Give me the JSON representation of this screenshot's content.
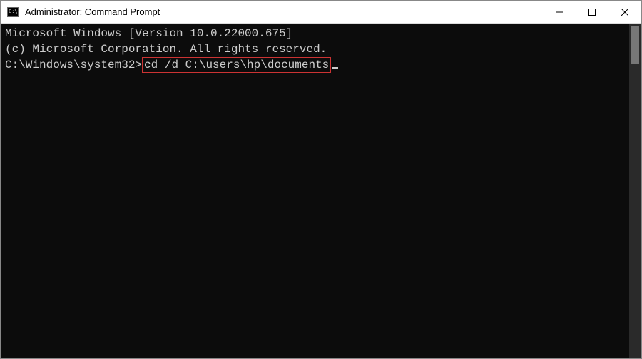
{
  "titlebar": {
    "icon_label": "C:\\",
    "title": "Administrator: Command Prompt"
  },
  "controls": {
    "minimize_label": "Minimize",
    "maximize_label": "Maximize",
    "close_label": "Close"
  },
  "console": {
    "line1": "Microsoft Windows [Version 10.0.22000.675]",
    "line2": "(c) Microsoft Corporation. All rights reserved.",
    "blank": "",
    "prompt": "C:\\Windows\\system32>",
    "command": "cd /d C:\\users\\hp\\documents"
  }
}
